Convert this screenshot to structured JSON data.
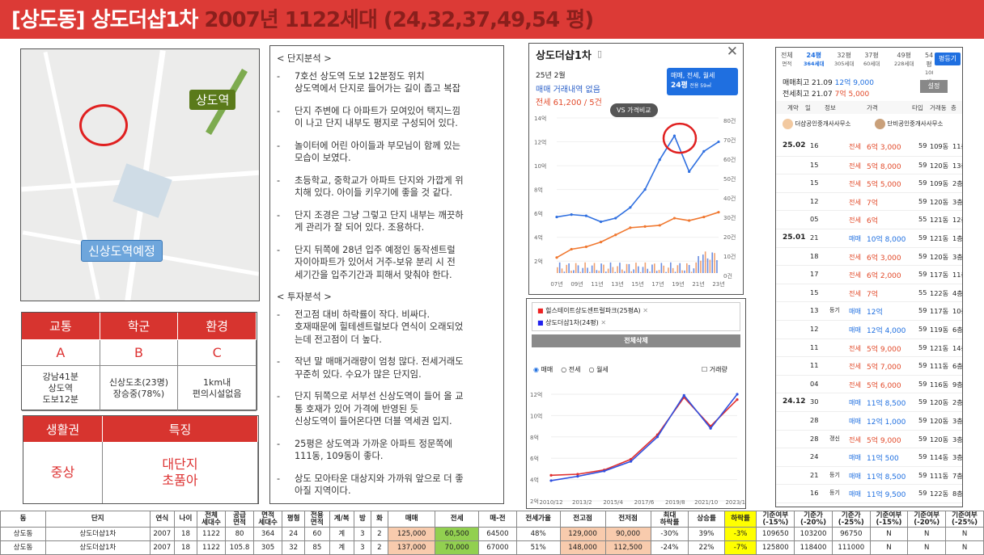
{
  "banner": {
    "title": "[상도동] 상도더샵1차",
    "tail": "2007년 1122세대 (24,32,37,49,54 평)"
  },
  "map": {
    "station": "상도역",
    "planned_station": "신상도역예정"
  },
  "ratings": {
    "headers": [
      "교통",
      "학군",
      "환경"
    ],
    "grades": [
      "A",
      "B",
      "C"
    ],
    "details": [
      "강남41분\n상도역\n도보12분",
      "신상도초(23명)\n장승중(78%)",
      "1km내\n편의시설없음"
    ]
  },
  "features": {
    "headers": [
      "생활권",
      "특징"
    ],
    "values": [
      "중상",
      "대단지\n초품아"
    ]
  },
  "analysis": {
    "title_top": "< 단지분석 >",
    "bullets1": [
      "7호선 상도역 도보 12분정도 위치\n상도역에서 단지로 들어가는 길이 좁고 복잡",
      "단지 주변에 다 아파트가 모여있어 택지느낌\n이 나고 단지 내부도 평지로 구성되어 있다.",
      "놀이터에 어린 아이들과 부모님이 함께 있는\n모습이 보였다.",
      "초등학교, 중학교가 아파트 단지와 가깝게 위\n치해 있다. 아이들 키우기에 좋을 것 같다.",
      "단지 조경은 그냥 그렇고 단지 내부는 깨끗하\n게 관리가 잘 되어 있다. 조용하다.",
      "단지 뒤쪽에 28년 입주 예정인 동작센트럴\n자이아파트가 있어서 거주-보유 분리 시 전\n세기간을 입주기간과 피해서 맞춰야 한다."
    ],
    "title_invest": "< 투자분석 >",
    "bullets2": [
      "전고점 대비 하락률이 작다. 비싸다.\n호재때문에 힐테센트럴보다 연식이 오래되었\n는데 전고점이 더 높다.",
      "작년 말 매매거래량이 엄청 많다. 전세거래도\n꾸준히 있다. 수요가 많은 단지임.",
      "단지 뒤쪽으로 서부선 신상도역이 들어 올 교\n통 호재가 있어 가격에 반영된 듯\n신상도역이 들어온다면 더블 역세권 입지.",
      "25평은 상도역과 가까운 아파트 정문쪽에\n111동, 109동이 좋다.",
      "상도 모아타운 대상지와 가까워 앞으로 더 좋\n아질 지역이다."
    ]
  },
  "chart1": {
    "title": "상도더샵1차",
    "date": "25년 2월",
    "no_trade": "매매 거래내역 없음",
    "jeonse": "전세 61,200 / 5건",
    "selector_line1": "매매, 전세, 월세",
    "selector_line2": "24평",
    "selector_sub": "전용 59㎡",
    "compare": "VS 가격비교",
    "chart_data": {
      "type": "line",
      "x": [
        "07년",
        "09년",
        "11년",
        "13년",
        "15년",
        "17년",
        "19년",
        "21년",
        "23년"
      ],
      "y_left_ticks": [
        "14억",
        "12억",
        "10억",
        "8억",
        "6억",
        "4억",
        "2억"
      ],
      "y_right_ticks": [
        "80건",
        "70건",
        "60건",
        "50건",
        "40건",
        "30건",
        "20건",
        "10건",
        "0건"
      ],
      "series": [
        {
          "name": "매매",
          "values": [
            5.7,
            5.9,
            5.8,
            5.3,
            5.6,
            6.5,
            8.0,
            10.5,
            12.5,
            9.5,
            11.2,
            12.0
          ]
        },
        {
          "name": "전세",
          "values": [
            2.3,
            3.0,
            3.2,
            3.6,
            4.2,
            4.8,
            4.9,
            5.0,
            5.6,
            5.4,
            5.7,
            6.1
          ]
        }
      ]
    }
  },
  "chart2": {
    "legend": [
      "힐스테이트상도센트럴파크(25평A)",
      "상도더샵1차(24평)"
    ],
    "button": "전체삭제",
    "radios": [
      "매매",
      "전세",
      "월세"
    ],
    "volume": "거래량",
    "chart_data": {
      "type": "line",
      "x": [
        "2010/12",
        "2013/2",
        "2015/4",
        "2017/6",
        "2019/8",
        "2021/10",
        "2023/12"
      ],
      "y_ticks": [
        "12억",
        "10억",
        "8억",
        "6억",
        "4억",
        "2억"
      ],
      "series": [
        {
          "name": "힐스테이트상도센트럴파크(25평A)",
          "values": [
            4.4,
            4.5,
            4.9,
            5.9,
            8.2,
            11.7,
            9.0,
            11.5
          ]
        },
        {
          "name": "상도더샵1차(24평)",
          "values": [
            3.9,
            4.3,
            4.8,
            5.7,
            8.0,
            11.9,
            8.8,
            12.0
          ]
        }
      ]
    }
  },
  "side": {
    "tabs": [
      [
        "전체",
        "면적"
      ],
      [
        "24평",
        "364세대"
      ],
      [
        "32평",
        "305세대"
      ],
      [
        "37평",
        "60세대"
      ],
      [
        "49평",
        "228세대"
      ],
      [
        "54평",
        "108세대"
      ]
    ],
    "btn": "평등기",
    "hist1": "매매최고 21.09",
    "hist1v": "12억 9,000",
    "hist2": "전세최고 21.07",
    "hist2v": "7억 5,000",
    "setting": "설정",
    "cols": [
      "계약",
      "일",
      "정보",
      "가격",
      "타입",
      "거래동",
      "층"
    ],
    "agents": [
      "더샵공인중개사사무소",
      "단비공인중개사사무소"
    ],
    "rows": [
      [
        "25.02",
        "16",
        "",
        "전세",
        "6억 3,000",
        "59",
        "109동",
        "11층"
      ],
      [
        "",
        "15",
        "",
        "전세",
        "5억 8,000",
        "59",
        "120동",
        "13층"
      ],
      [
        "",
        "15",
        "",
        "전세",
        "5억 5,000",
        "59",
        "109동",
        "2층"
      ],
      [
        "",
        "12",
        "",
        "전세",
        "7억",
        "59",
        "120동",
        "3층"
      ],
      [
        "",
        "05",
        "",
        "전세",
        "6억",
        "55",
        "121동",
        "12층"
      ],
      [
        "25.01",
        "21",
        "",
        "매매",
        "10억 8,000",
        "59",
        "121동",
        "1층"
      ],
      [
        "",
        "18",
        "",
        "전세",
        "6억 3,000",
        "59",
        "120동",
        "3층"
      ],
      [
        "",
        "17",
        "",
        "전세",
        "6억 2,000",
        "59",
        "117동",
        "11층"
      ],
      [
        "",
        "15",
        "",
        "전세",
        "7억",
        "55",
        "122동",
        "4층"
      ],
      [
        "",
        "13",
        "등기",
        "매매",
        "12억",
        "59",
        "117동",
        "10층"
      ],
      [
        "",
        "12",
        "",
        "매매",
        "12억 4,000",
        "59",
        "119동",
        "6층"
      ],
      [
        "",
        "11",
        "",
        "전세",
        "5억 9,000",
        "59",
        "121동",
        "14층"
      ],
      [
        "",
        "11",
        "",
        "전세",
        "5억 7,000",
        "59",
        "111동",
        "6층"
      ],
      [
        "",
        "04",
        "",
        "전세",
        "5억 6,000",
        "59",
        "116동",
        "9층"
      ],
      [
        "24.12",
        "30",
        "",
        "매매",
        "11억 8,500",
        "59",
        "120동",
        "2층"
      ],
      [
        "",
        "28",
        "",
        "매매",
        "12억 1,000",
        "59",
        "120동",
        "3층"
      ],
      [
        "",
        "28",
        "갱신",
        "전세",
        "5억 9,000",
        "59",
        "120동",
        "3층"
      ],
      [
        "",
        "24",
        "",
        "매매",
        "11억 500",
        "59",
        "114동",
        "3층"
      ],
      [
        "",
        "21",
        "등기",
        "매매",
        "11억 8,500",
        "59",
        "111동",
        "7층"
      ],
      [
        "",
        "16",
        "등기",
        "매매",
        "11억 9,500",
        "59",
        "122동",
        "8층"
      ],
      [
        "",
        "13",
        "",
        "매매",
        "11억 5,500",
        "59",
        "114동",
        "12층"
      ]
    ]
  },
  "table": {
    "headers": [
      "동",
      "단지",
      "연식",
      "나이",
      "전체\n세대수",
      "공급\n면적",
      "면적\n세대수",
      "평형",
      "전용\n면적",
      "계/복",
      "방",
      "화",
      "매매",
      "전세",
      "매-전",
      "전세가율",
      "전고점",
      "전저점",
      "최대\n하락률",
      "상승률",
      "하락률",
      "기준여부\n(-15%)",
      "기준가\n(-20%)",
      "기준가\n(-25%)",
      "기준여부\n(-15%)",
      "기준여부\n(-20%)",
      "기준여부\n(-25%)"
    ],
    "rows": [
      [
        "상도동",
        "상도더샵1차",
        "2007",
        "18",
        "1122",
        "80",
        "364",
        "24",
        "60",
        "계",
        "3",
        "2",
        "125,000",
        "60,500",
        "64500",
        "48%",
        "129,000",
        "90,000",
        "-30%",
        "39%",
        "-3%",
        "109650",
        "103200",
        "96750",
        "N",
        "N",
        "N"
      ],
      [
        "상도동",
        "상도더샵1차",
        "2007",
        "18",
        "1122",
        "105.8",
        "305",
        "32",
        "85",
        "계",
        "3",
        "2",
        "137,000",
        "70,000",
        "67000",
        "51%",
        "148,000",
        "112,500",
        "-24%",
        "22%",
        "-7%",
        "125800",
        "118400",
        "111000",
        "N",
        "N",
        "N"
      ]
    ]
  }
}
